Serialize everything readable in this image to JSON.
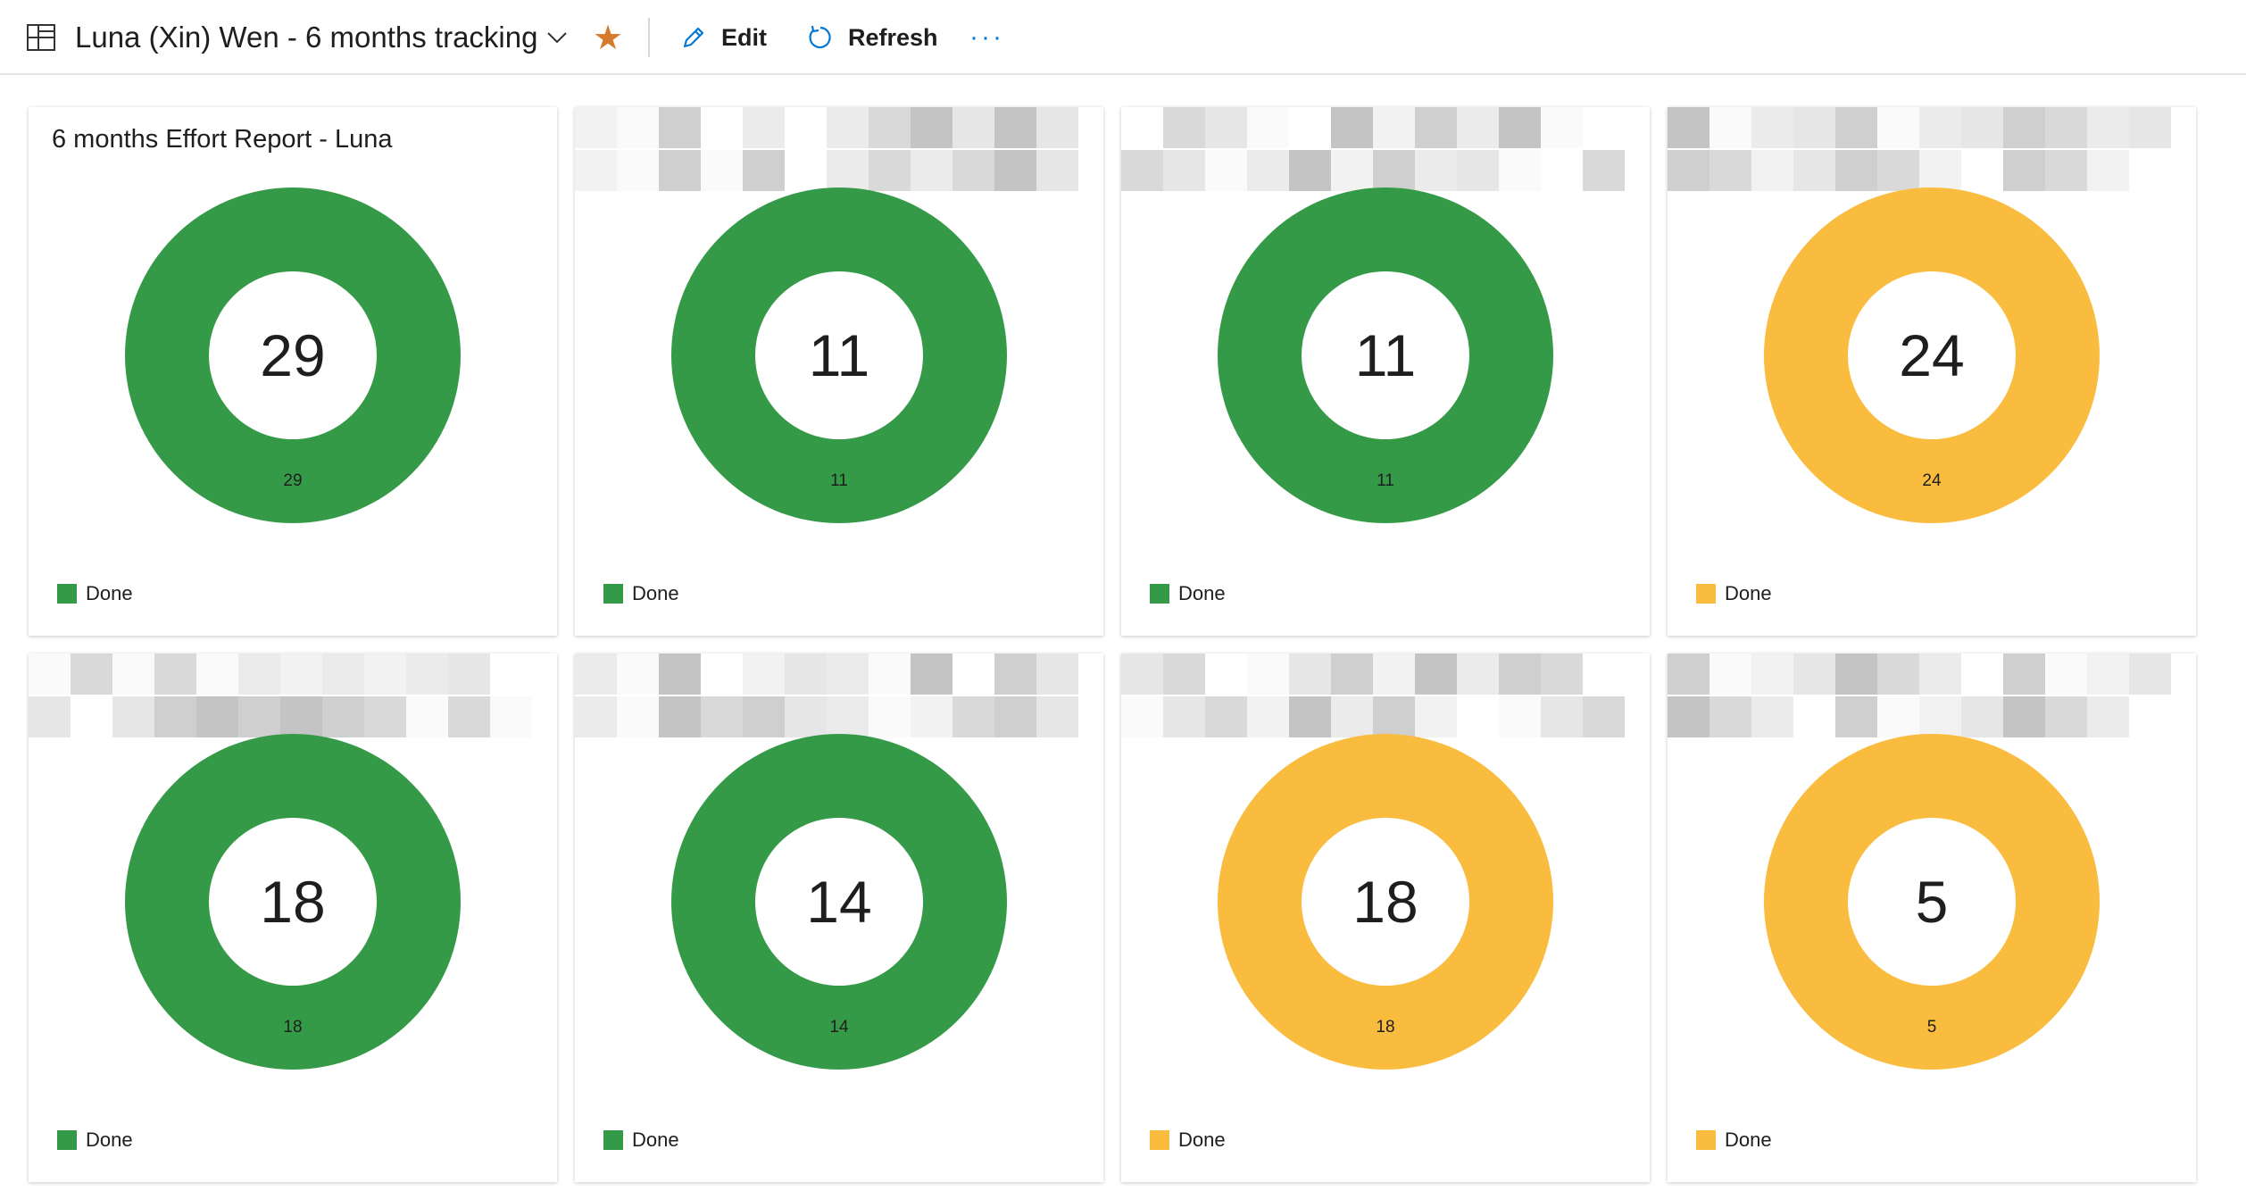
{
  "header": {
    "title": "Luna (Xin) Wen - 6 months tracking",
    "edit_label": "Edit",
    "refresh_label": "Refresh",
    "more_label": "···",
    "favorite_icon": "star-icon",
    "favorite_color": "#d87a2e"
  },
  "colors": {
    "done_green": "#359a48",
    "done_yellow": "#f9bc3e"
  },
  "widgets": [
    {
      "title": "6 months Effort Report - Luna",
      "total": "29",
      "slice_label": "29",
      "legend": "Done",
      "color": "#359a48"
    },
    {
      "title": "",
      "total": "11",
      "slice_label": "11",
      "legend": "Done",
      "color": "#359a48"
    },
    {
      "title": "",
      "total": "11",
      "slice_label": "11",
      "legend": "Done",
      "color": "#359a48"
    },
    {
      "title": "",
      "total": "24",
      "slice_label": "24",
      "legend": "Done",
      "color": "#f9bc3e"
    },
    {
      "title": "",
      "total": "18",
      "slice_label": "18",
      "legend": "Done",
      "color": "#359a48"
    },
    {
      "title": "",
      "total": "14",
      "slice_label": "14",
      "legend": "Done",
      "color": "#359a48"
    },
    {
      "title": "",
      "total": "18",
      "slice_label": "18",
      "legend": "Done",
      "color": "#f9bc3e"
    },
    {
      "title": "",
      "total": "5",
      "slice_label": "5",
      "legend": "Done",
      "color": "#f9bc3e"
    }
  ]
}
